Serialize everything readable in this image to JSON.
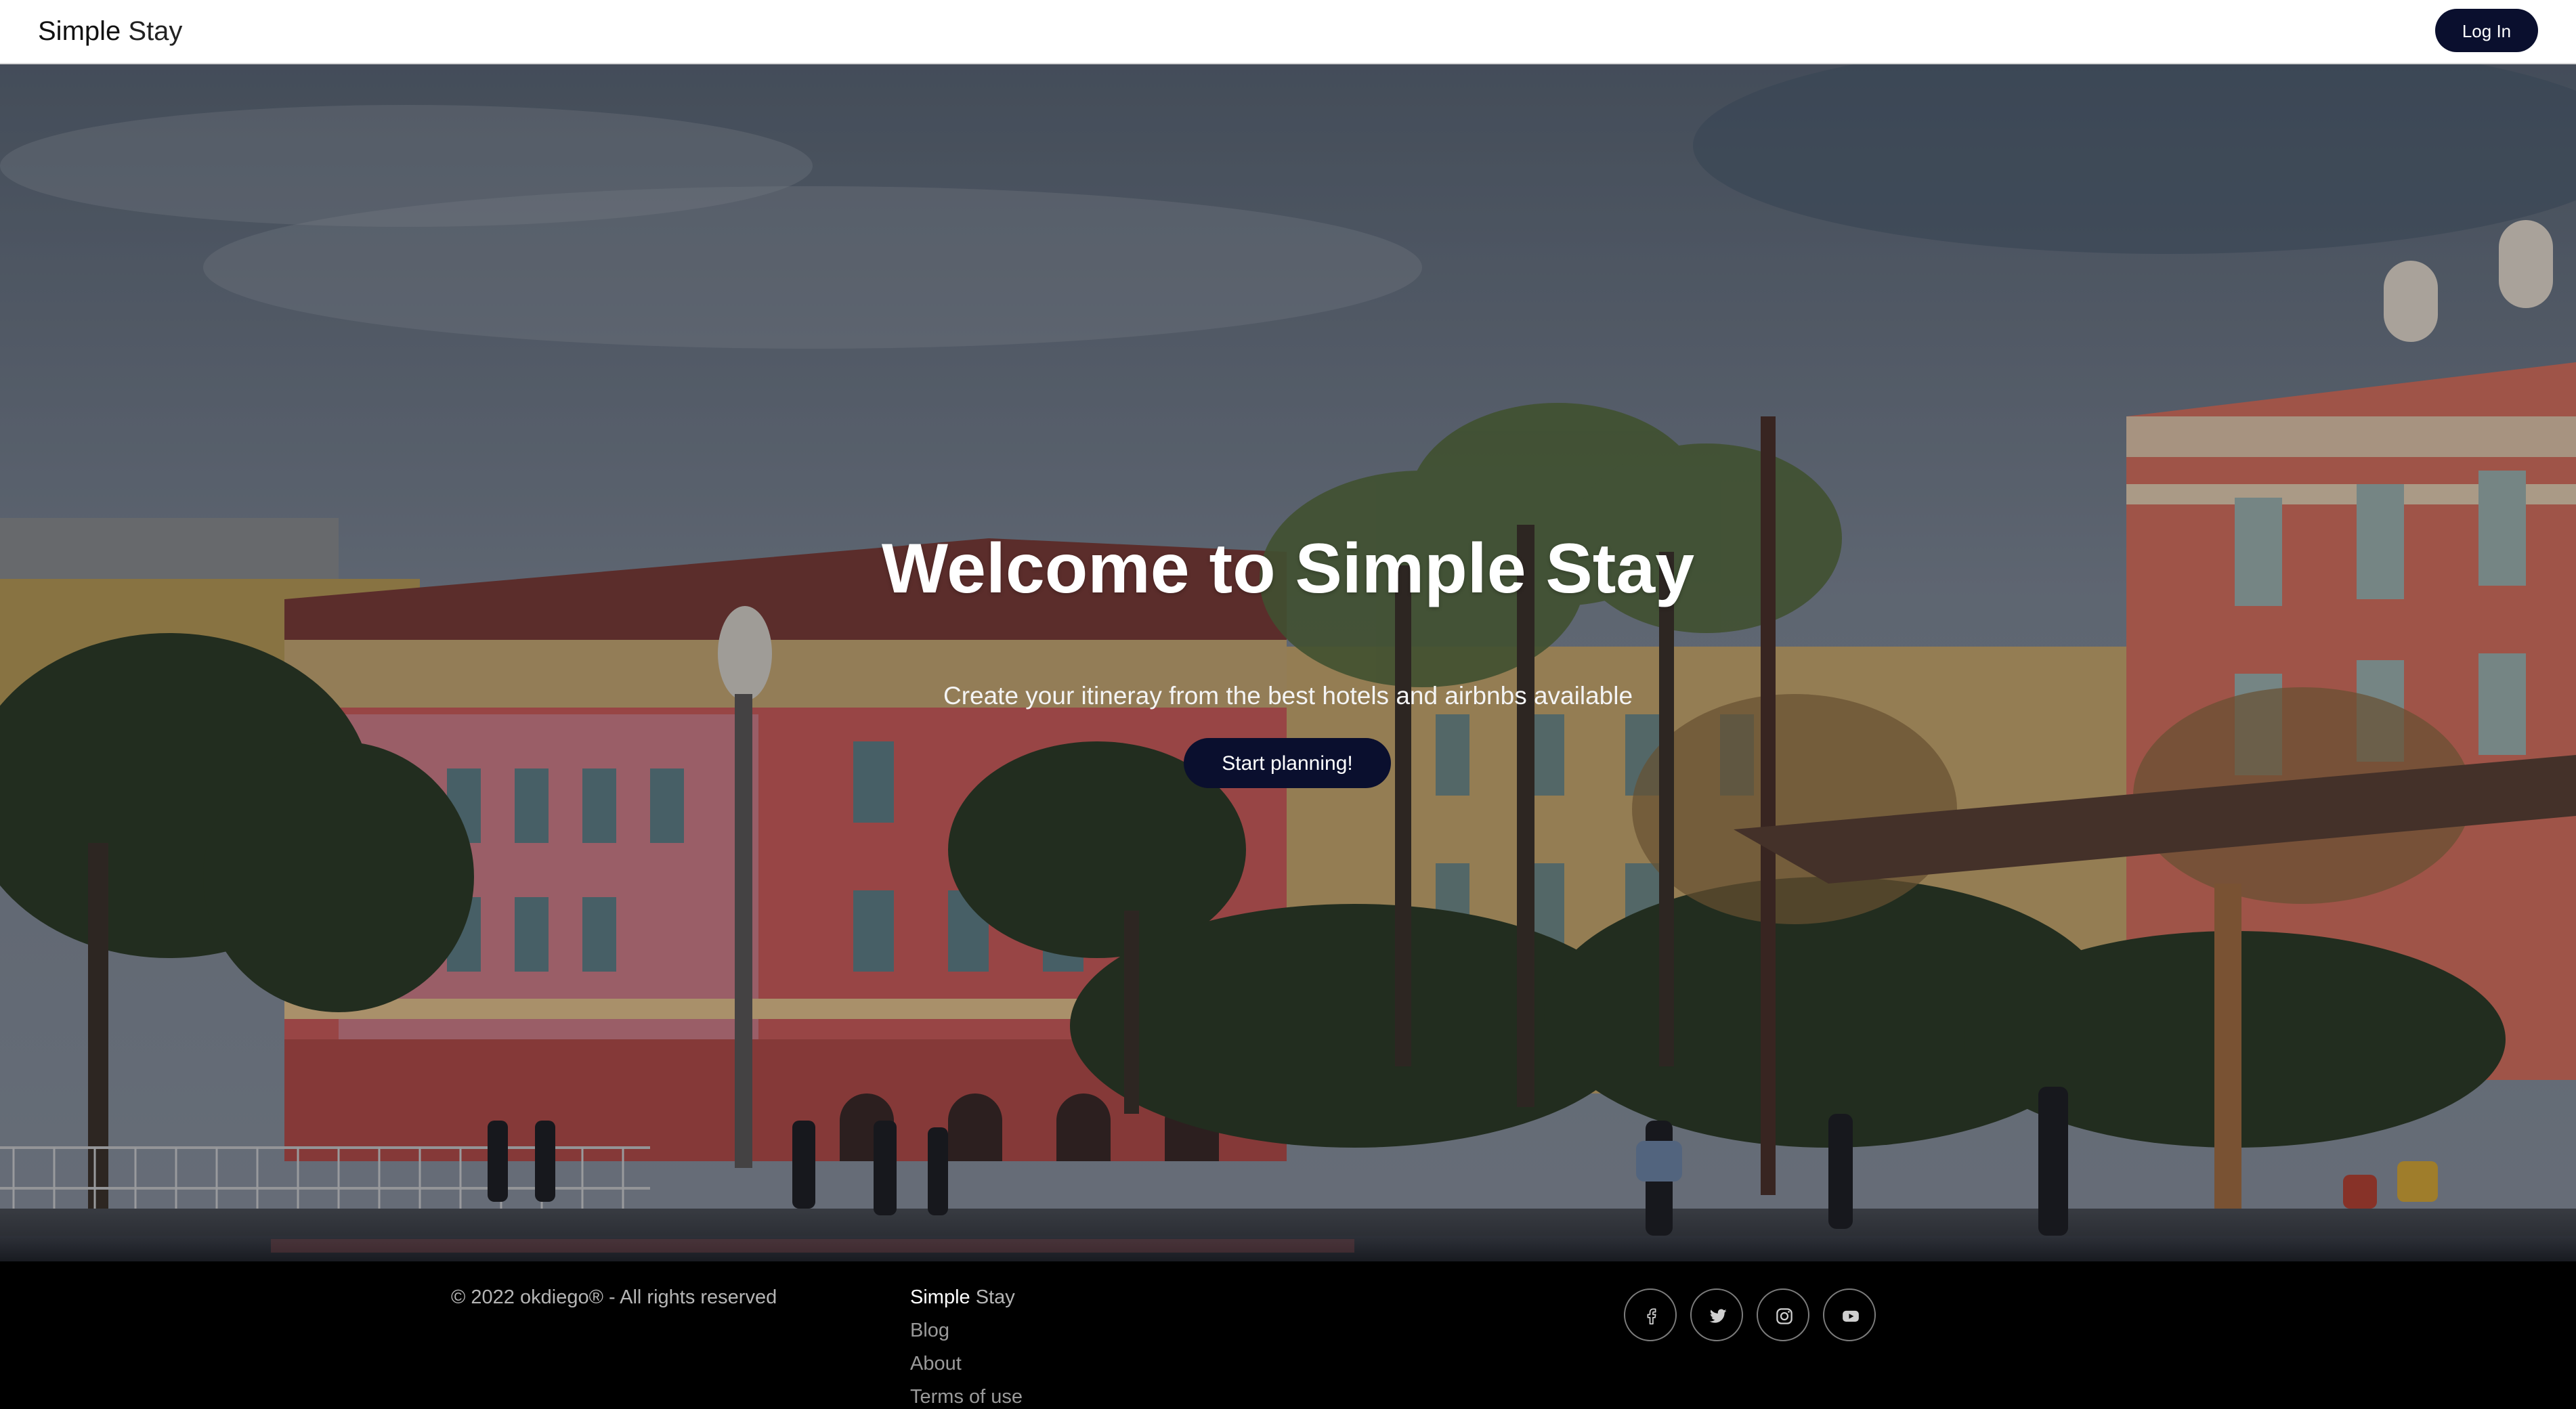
{
  "header": {
    "brand_part1": "Simple",
    "brand_part2": "Stay",
    "login_label": "Log In"
  },
  "hero": {
    "title": "Welcome to Simple Stay",
    "subtitle": "Create your itineray from the best hotels and airbnbs available",
    "cta_label": "Start planning!",
    "background": "city square with pink and red buildings, palm trees and pedestrians under a cloudy sky"
  },
  "footer": {
    "copyright": "© 2022 okdiego® - All rights reserved",
    "brand_part1": "Simple",
    "brand_part2": "Stay",
    "links": [
      "Blog",
      "About",
      "Terms of use"
    ],
    "social_icons": [
      "facebook-icon",
      "twitter-icon",
      "instagram-icon",
      "youtube-icon"
    ]
  },
  "colors": {
    "primary_button": "#0a0f2e",
    "header_bg": "#ffffff",
    "footer_bg": "#000000"
  }
}
